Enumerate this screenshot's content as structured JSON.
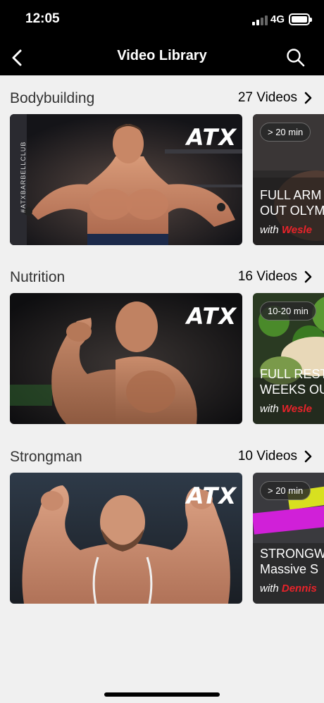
{
  "status": {
    "time": "12:05",
    "network": "4G"
  },
  "nav": {
    "title": "Video Library"
  },
  "sections": [
    {
      "title": "Bodybuilding",
      "count": "27 Videos",
      "main_logo": "ATX",
      "main_side_text": "#ATXBARBELLCLUB",
      "next": {
        "duration": "> 20 min",
        "title_line1": "FULL ARM",
        "title_line2": "OUT OLYM",
        "author_prefix": "with",
        "author_name": "Wesle"
      }
    },
    {
      "title": "Nutrition",
      "count": "16 Videos",
      "main_logo": "ATX",
      "next": {
        "duration": "10-20 min",
        "title_line1": "FULL REST",
        "title_line2": "WEEKS OU",
        "author_prefix": "with",
        "author_name": "Wesle"
      }
    },
    {
      "title": "Strongman",
      "count": "10 Videos",
      "main_logo": "ATX",
      "next": {
        "duration": "> 20 min",
        "title_line1": "STRONGW",
        "title_line2": "Massive S",
        "author_prefix": "with",
        "author_name": "Dennis"
      }
    }
  ],
  "colors": {
    "accent_red": "#e8232a",
    "background": "#f0f0f0",
    "bar": "#000000"
  }
}
